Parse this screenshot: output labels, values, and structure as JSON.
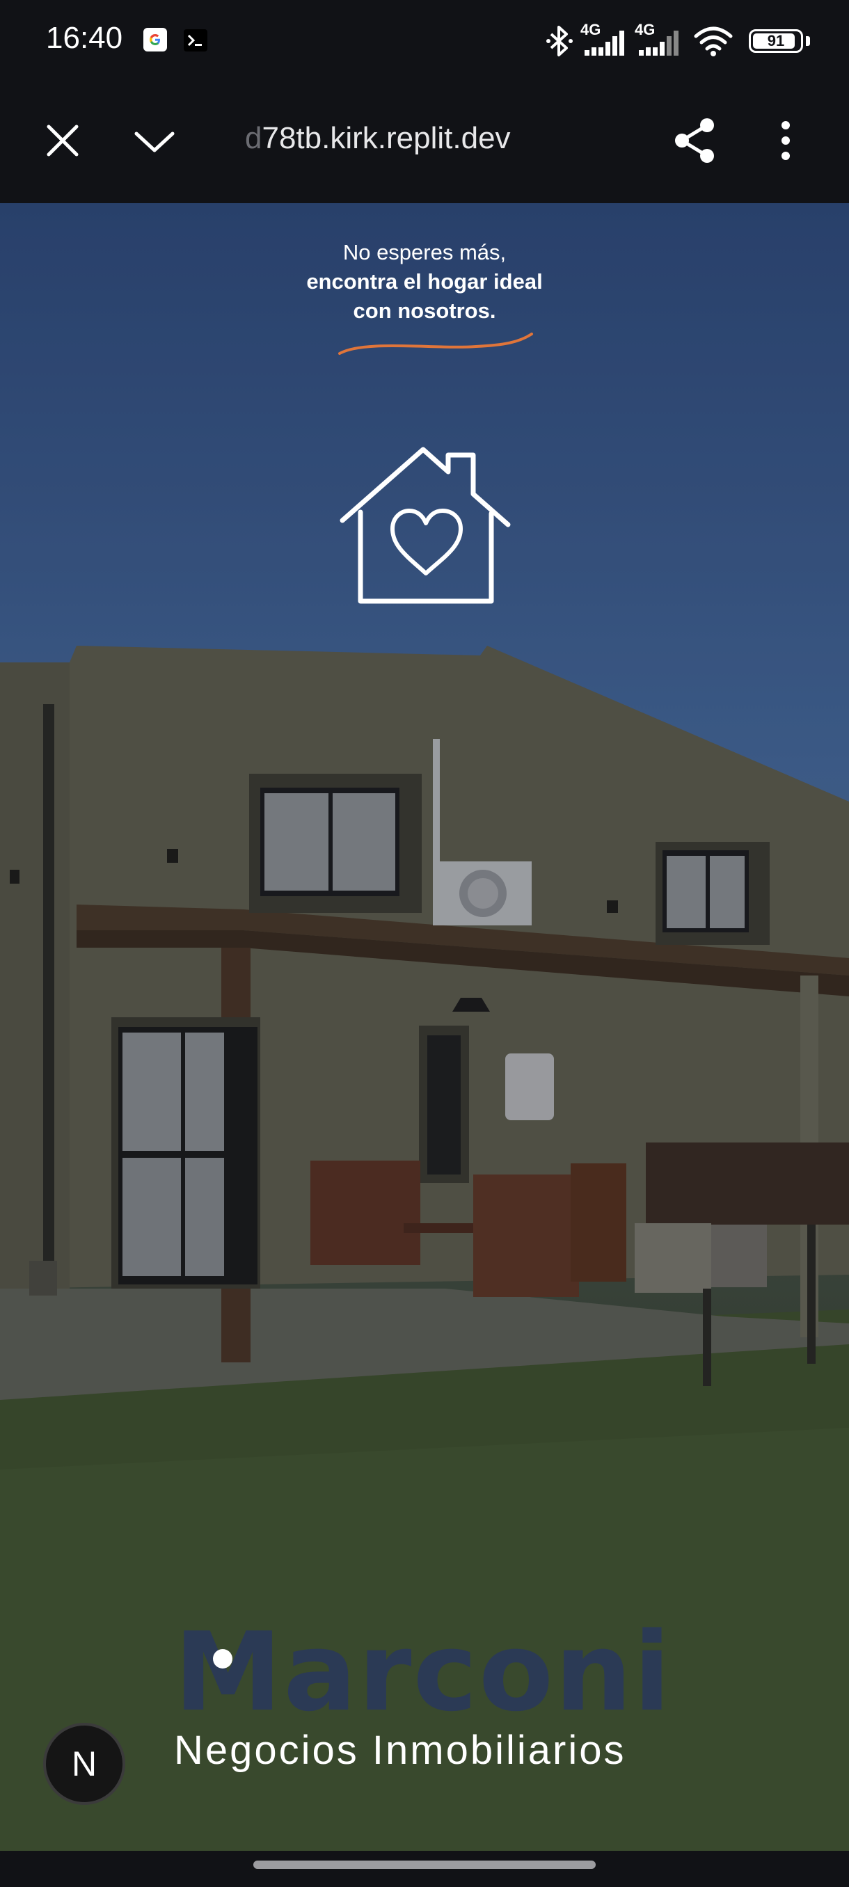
{
  "status_bar": {
    "time": "16:40",
    "notification_icons": [
      "google-icon",
      "terminal-icon"
    ],
    "network_1": "4G",
    "network_2": "4G",
    "battery": "91",
    "battery_level": 0.91
  },
  "browser": {
    "url_faded": "d",
    "url": "78tb.kirk.replit.dev",
    "close_icon": "close-icon",
    "minimize_icon": "chevron-down-icon",
    "share_icon": "share-icon",
    "menu_icon": "more-vert-icon"
  },
  "hero": {
    "tagline_line1": "No esperes más,",
    "tagline_line2": "encontra el hogar ideal",
    "tagline_line3": "con nosotros.",
    "underline_color": "#e0753a",
    "house_icon": "house-heart-icon"
  },
  "brand": {
    "name": "Marconi",
    "subtitle": "Negocios Inmobiliarios"
  },
  "dev_badge": {
    "letter": "N"
  }
}
